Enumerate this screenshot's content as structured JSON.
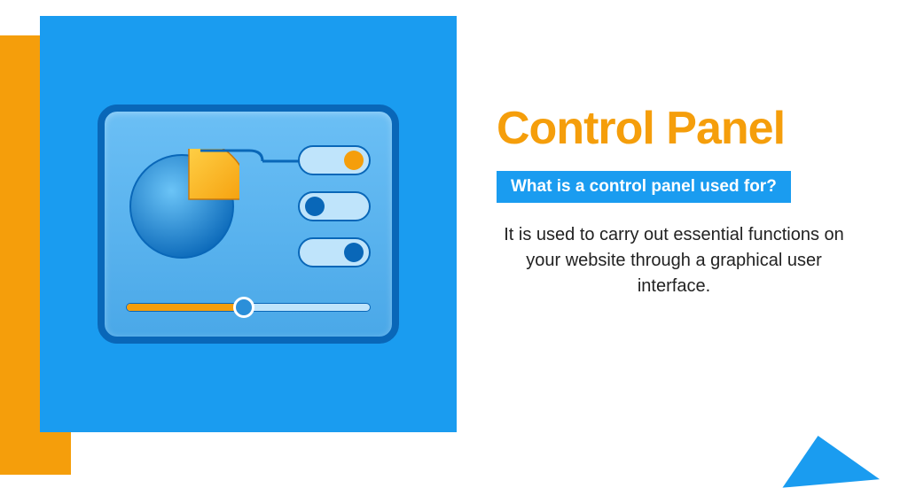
{
  "title": "Control Panel",
  "subtitle": "What is a control panel used for?",
  "body": "It is used to carry out essential functions on your website through a graphical user interface.",
  "colors": {
    "accent_orange": "#f59e0b",
    "accent_blue": "#1a9cf0",
    "dark_blue": "#0967b8"
  },
  "illustration": {
    "pie_slice_percent": 25,
    "toggles": [
      {
        "state": "on",
        "color": "orange"
      },
      {
        "state": "off",
        "color": "blue"
      },
      {
        "state": "on",
        "color": "blue"
      }
    ],
    "slider_percent": 48
  }
}
